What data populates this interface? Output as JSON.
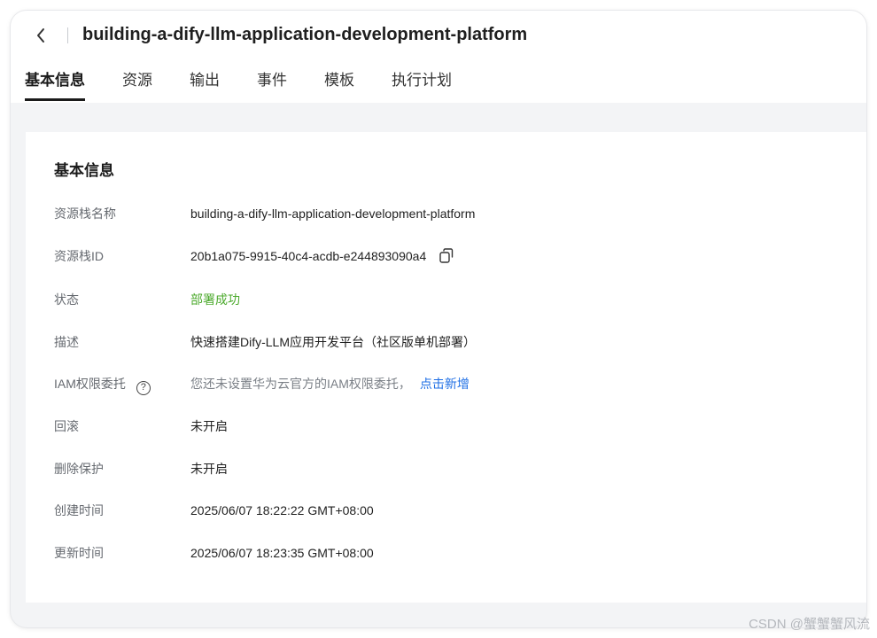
{
  "header": {
    "title": "building-a-dify-llm-application-development-platform"
  },
  "tabs": [
    {
      "label": "基本信息",
      "active": true
    },
    {
      "label": "资源",
      "active": false
    },
    {
      "label": "输出",
      "active": false
    },
    {
      "label": "事件",
      "active": false
    },
    {
      "label": "模板",
      "active": false
    },
    {
      "label": "执行计划",
      "active": false
    }
  ],
  "info": {
    "section_title": "基本信息",
    "rows": [
      {
        "label": "资源栈名称",
        "value": "building-a-dify-llm-application-development-platform"
      },
      {
        "label": "资源栈ID",
        "value": "20b1a075-9915-40c4-acdb-e244893090a4"
      },
      {
        "label": "状态",
        "value": "部署成功"
      },
      {
        "label": "描述",
        "value": "快速搭建Dify-LLM应用开发平台（社区版单机部署）"
      },
      {
        "label": "IAM权限委托",
        "value": "您还未设置华为云官方的IAM权限委托，",
        "link": "点击新增"
      },
      {
        "label": "回滚",
        "value": "未开启"
      },
      {
        "label": "删除保护",
        "value": "未开启"
      },
      {
        "label": "创建时间",
        "value": "2025/06/07 18:22:22 GMT+08:00"
      },
      {
        "label": "更新时间",
        "value": "2025/06/07 18:23:35 GMT+08:00"
      }
    ]
  },
  "icons": {
    "back": "chevron-left-icon",
    "copy": "copy-icon",
    "help": "question-circle-icon"
  },
  "colors": {
    "status_success": "#4caa2d",
    "link": "#1f6fe5"
  },
  "watermark": "CSDN @蟹蟹蟹风流"
}
